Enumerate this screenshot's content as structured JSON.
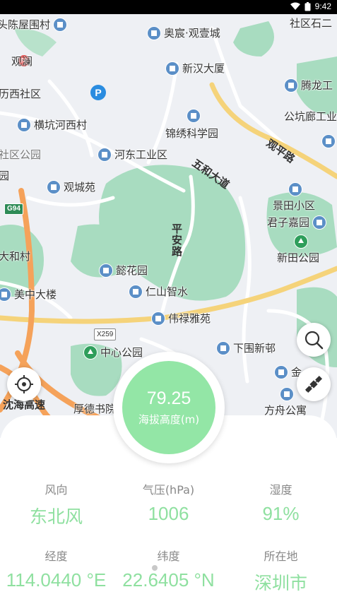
{
  "status_bar": {
    "time": "9:42"
  },
  "map": {
    "pois": {
      "chenwu": "头陈屋围村",
      "guanlan": "观澜",
      "lixi": "历西社区",
      "hengkeng": "横坑河西村",
      "shequ_park": "社区公园",
      "yuan": "园",
      "hedong": "河东工业区",
      "guancheng": "观城苑",
      "aochen": "奥宸·观壹城",
      "xinhan": "新汉大厦",
      "jinxiu": "锦绣科学园",
      "wuhe": "五和大道",
      "guanping": "观平路",
      "pingan": "平安路",
      "tenglong": "腾龙工",
      "gongkeng": "公坑廊工业",
      "shequ_top": "社区石二",
      "jingtian": "景田小区",
      "junzi": "君子嘉园",
      "xintian": "新田公园",
      "dahe": "大和村",
      "meizhong": "美中大楼",
      "yihua": "懿花园",
      "renshan": "仁山智水",
      "weilu": "伟禄雅苑",
      "zhongxin": "中心公园",
      "xiawei": "下围新邨",
      "jin": "金",
      "fangzhou": "方舟公寓",
      "houde": "厚德书院",
      "yanhai": "沈海高速",
      "g94": "G94",
      "x259": "X259",
      "parking": "P"
    }
  },
  "altitude": {
    "value": "79.25",
    "unit_label": "海拔高度(m)"
  },
  "stats": {
    "wind_title": "风向",
    "wind_value": "东北风",
    "pressure_title": "气压(hPa)",
    "pressure_value": "1006",
    "humidity_title": "湿度",
    "humidity_value": "91%",
    "lon_title": "经度",
    "lon_value": "114.0440 °E",
    "lat_title": "纬度",
    "lat_value": "22.6405 °N",
    "city_title": "所在地",
    "city_value": "深圳市"
  },
  "colors": {
    "accent": "#93e6a6",
    "accent_text": "#8fe0a0",
    "park": "#a8dcc0",
    "major_road": "#f5a25a",
    "secondary_road": "#f5d37a"
  }
}
